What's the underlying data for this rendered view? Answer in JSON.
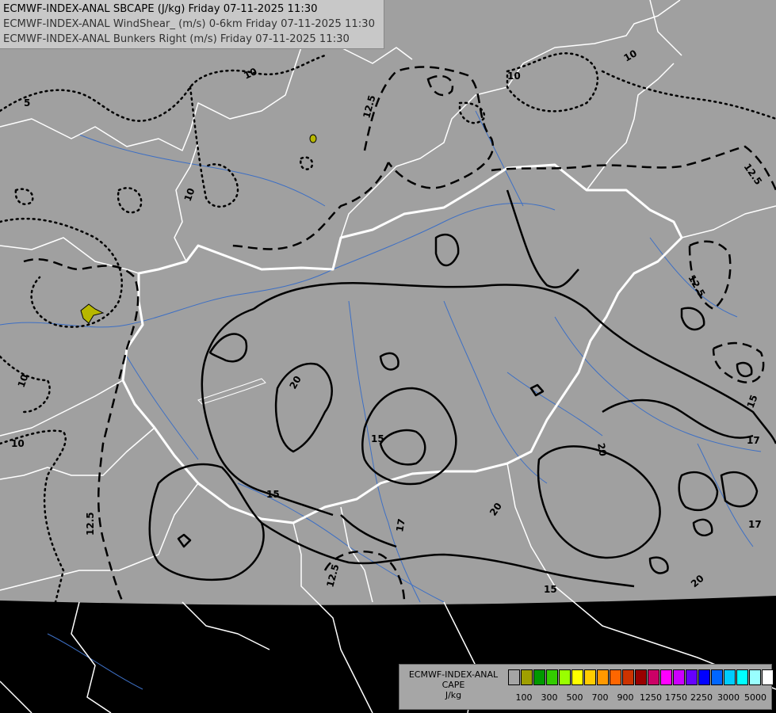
{
  "header": {
    "lines": [
      "ECMWF-INDEX-ANAL SBCAPE (J/kg) Friday 07-11-2025 11:30",
      "ECMWF-INDEX-ANAL WindShear_ (m/s) 0-6km Friday 07-11-2025 11:30",
      "ECMWF-INDEX-ANAL Bunkers Right (m/s) Friday 07-11-2025 11:30"
    ]
  },
  "legend": {
    "title_lines": [
      "ECMWF-INDEX-ANAL",
      "CAPE",
      "J/kg"
    ],
    "colors": [
      "#a5a5a5",
      "#9f9f00",
      "#009900",
      "#33cc00",
      "#99ff00",
      "#ffff00",
      "#ffcc00",
      "#ff9900",
      "#ff6600",
      "#cc3300",
      "#990000",
      "#cc0066",
      "#ff00ff",
      "#cc00ff",
      "#6600ff",
      "#0000ff",
      "#0066ff",
      "#00ccff",
      "#00ffff",
      "#99ffff",
      "#ffffff"
    ],
    "tick_labels": [
      "100",
      "300",
      "500",
      "700",
      "900",
      "1250",
      "1750",
      "2250",
      "3000",
      "5000"
    ]
  },
  "contour_labels": {
    "windshear_dotted": [
      "10",
      "10",
      "10",
      "10",
      "10",
      "10",
      "5"
    ],
    "windshear_dashed": [
      "12.5",
      "12.5",
      "12.5",
      "12.5",
      "12.5"
    ],
    "bunkers_solid": [
      "20",
      "15",
      "15",
      "17",
      "20",
      "20",
      "17",
      "15",
      "17",
      "15",
      "20"
    ]
  },
  "colors": {
    "background": "#000000",
    "data_domain": "#a0a0a0",
    "borders": "#ffffff",
    "rivers": "#3d6fc4",
    "contours": "#000000",
    "cape_fill": "#b7b700"
  }
}
